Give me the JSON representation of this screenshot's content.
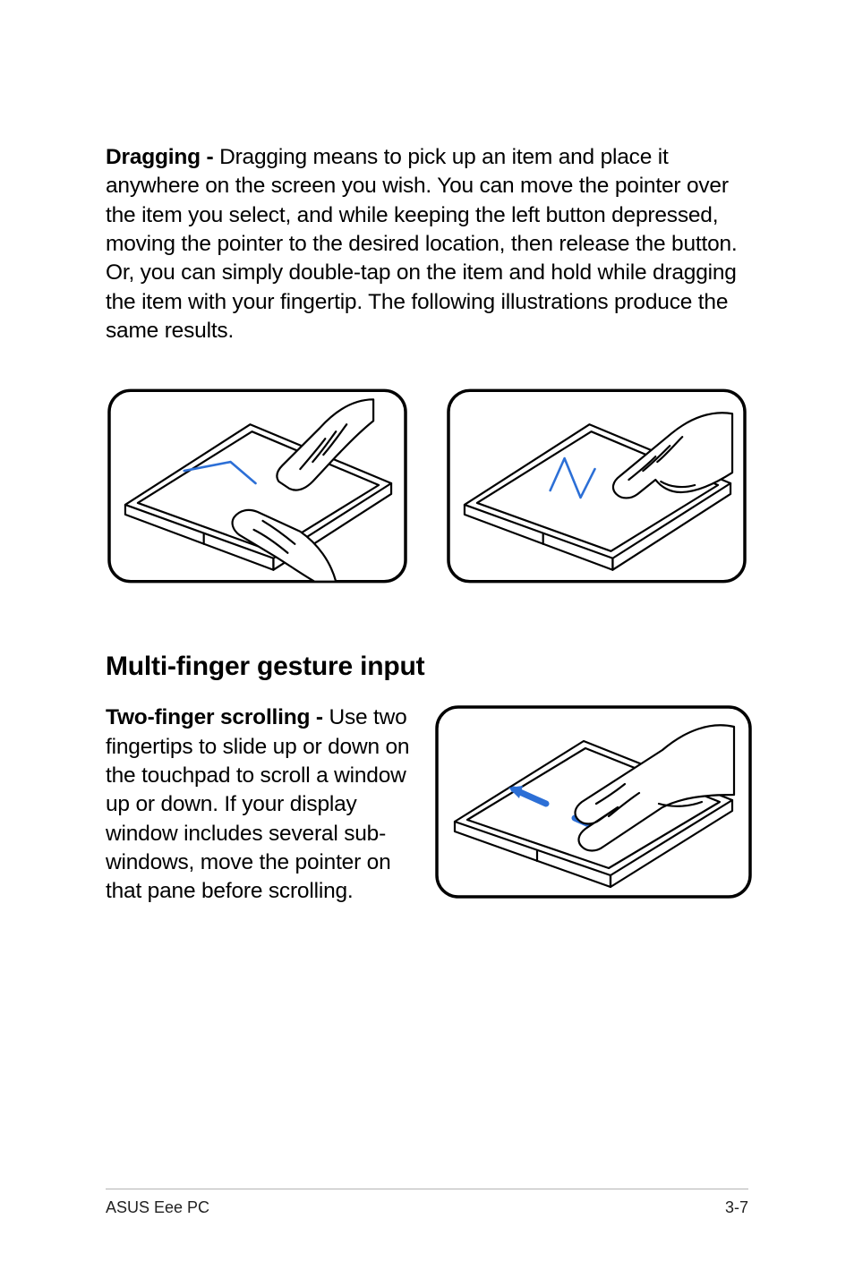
{
  "section1": {
    "drag_label": "Dragging - ",
    "drag_body": "Dragging means to pick up an item and place it anywhere on the screen you wish. You can move the pointer over the item you select, and while keeping the left button depressed, moving the pointer to the desired location, then release the button. Or, you can simply double-tap on the item and hold while dragging the item with your fingertip. The following illustrations produce the same results."
  },
  "section2": {
    "heading": "Multi-finger gesture input",
    "twofinger_label": "Two-finger scrolling - ",
    "twofinger_body": "Use two fingertips to slide up or down on the touchpad to scroll a window up or down. If your display window includes several sub-windows, move the pointer on that pane before scrolling."
  },
  "footer": {
    "left": "ASUS Eee PC",
    "right": "3-7"
  }
}
